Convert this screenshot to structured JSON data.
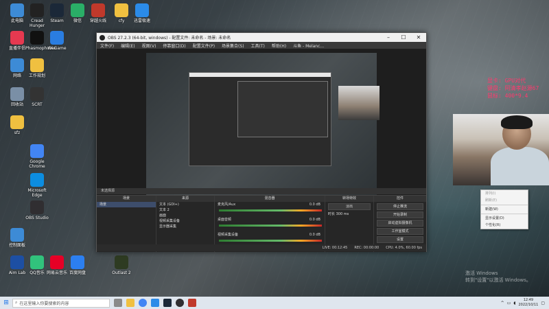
{
  "desktop": {
    "icons": [
      {
        "label": "此电脑",
        "color": "#3d8bd6"
      },
      {
        "label": "Cread Hunger",
        "color": "#222222"
      },
      {
        "label": "Steam",
        "color": "#1b2838"
      },
      {
        "label": "微信",
        "color": "#2aae67"
      },
      {
        "label": "穿越火线",
        "color": "#c0392b"
      },
      {
        "label": "cfy",
        "color": "#f0c040"
      },
      {
        "label": "迅雷极速",
        "color": "#2b8be8"
      },
      {
        "label": "直播伴侣",
        "color": "#e53950"
      },
      {
        "label": "Phasmophobia",
        "color": "#111111"
      },
      {
        "label": "WeGame",
        "color": "#2a7de1"
      },
      {
        "label": "网络",
        "color": "#3d8bd6"
      },
      {
        "label": "工作规划",
        "color": "#f0c040"
      },
      {
        "label": "回收站",
        "color": "#7a8fa6"
      },
      {
        "label": "SCRT",
        "color": "#333333"
      },
      {
        "label": "sfz",
        "color": "#f0c040"
      },
      {
        "label": "Google Chrome",
        "color": "#4285f4"
      },
      {
        "label": "Microsoft Edge",
        "color": "#0c8de0"
      },
      {
        "label": "OBS Studio",
        "color": "#302e31"
      },
      {
        "label": "控制面板",
        "color": "#3d8bd6"
      },
      {
        "label": "Aim Lab",
        "color": "#1d4fa3"
      },
      {
        "label": "QQ音乐",
        "color": "#31c27c"
      },
      {
        "label": "网易云音乐",
        "color": "#e60026"
      },
      {
        "label": "百度网盘",
        "color": "#2c7ff0"
      },
      {
        "label": "Outlast 2",
        "color": "#2e3b22"
      }
    ]
  },
  "obs": {
    "title": "OBS 27.2.3 (64-bit, windows) - 配置文件: 未命名 - 场景: 未命名",
    "menu": [
      "文件(F)",
      "编辑(E)",
      "视图(V)",
      "停靠窗口(D)",
      "配置文件(P)",
      "场景集合(S)",
      "工具(T)",
      "帮助(H)",
      "斗鱼 - Melanc..."
    ],
    "tabs_label": "未选择源",
    "scenes_header": "场景",
    "scene_name": "场景",
    "sources_header": "来源",
    "sources": [
      "文本 (GDI+)",
      "文本 2",
      "画面",
      "视频采集设备",
      "显示器采集"
    ],
    "mixer_header": "混音器",
    "mixer_channels": [
      {
        "name": "麦克风/Aux",
        "db": "0.0 dB"
      },
      {
        "name": "桌面音频",
        "db": "0.0 dB"
      },
      {
        "name": "视频采集设备",
        "db": "0.0 dB"
      }
    ],
    "transitions_header": "转场特效",
    "transition_name": "淡出",
    "duration_label": "时长",
    "duration_value": "300 ms",
    "controls_header": "控件",
    "controls": [
      "停止推流",
      "开始录制",
      "启动虚拟摄像机",
      "工作室模式",
      "设置",
      "退出"
    ],
    "status": [
      "LIVE: 00:12:45",
      "REC: 00:00:00",
      "CPU: 4.0%, 60.00 fps"
    ]
  },
  "overlay": {
    "stats_lines": [
      "显卡: GPU对代",
      "键盘: 阿清孝赵源67",
      "鼠标: 400*9.4"
    ]
  },
  "context_menu": {
    "items": [
      {
        "label": "排列(I)",
        "dim": true
      },
      {
        "label": "刷新(E)",
        "dim": true
      },
      {
        "label": "新建(W)",
        "dim": false
      },
      {
        "label": "显示设置(D)",
        "dim": false
      },
      {
        "label": "个性化(R)",
        "dim": false
      }
    ]
  },
  "watermark": {
    "line1": "激活 Windows",
    "line2": "转到\"设置\"以激活 Windows。"
  },
  "taskbar": {
    "search_placeholder": "在这里输入你要搜索的内容",
    "time": "12:49",
    "date": "2022/10/11"
  }
}
